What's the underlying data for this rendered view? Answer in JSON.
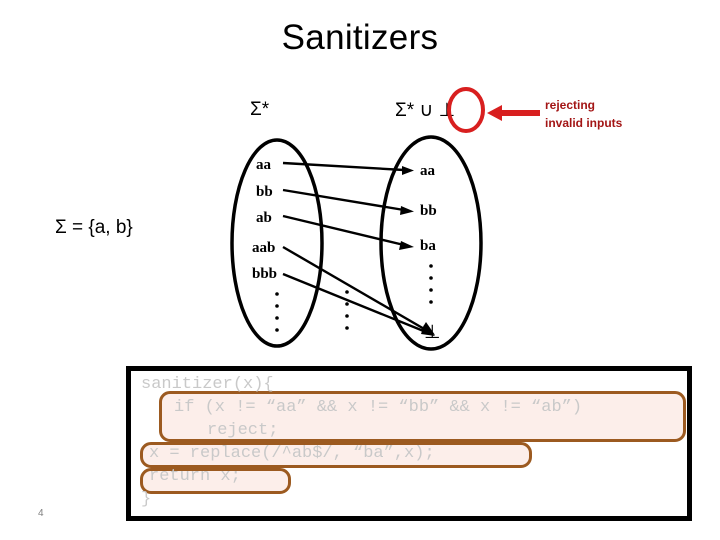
{
  "slide": {
    "title": "Sanitizers",
    "page_number": "4"
  },
  "labels": {
    "left_set": "Σ*",
    "right_set": "Σ* ∪ ⊥",
    "alphabet": "Σ = {a, b}"
  },
  "annotation": {
    "line1": "rejecting",
    "line2": "invalid inputs",
    "color": "#a31515"
  },
  "diagram": {
    "left_set_elements": [
      "aa",
      "bb",
      "ab",
      "aab",
      "bbb"
    ],
    "left_set_ellipsis": "⋮",
    "middle_ellipsis": "⋮",
    "right_set_elements": [
      "aa",
      "bb",
      "ba"
    ],
    "right_set_ellipsis": "⋮",
    "right_set_bottom": "⊥",
    "mappings": [
      {
        "from": "aa",
        "to": "aa"
      },
      {
        "from": "bb",
        "to": "bb"
      },
      {
        "from": "ab",
        "to": "ba"
      },
      {
        "from": "aab",
        "to": "⊥"
      },
      {
        "from": "bbb",
        "to": "⊥"
      }
    ]
  },
  "code": {
    "lines": [
      "sanitizer(x){",
      "if (x != “aa” && x != “bb” && x != “ab”)",
      "reject;",
      "x = replace(/^ab$/, “ba”,x);",
      "return x;",
      "}"
    ],
    "highlight_border_color": "#9c5a20",
    "highlight_fill_color": "#fceeea",
    "text_color": "#c9c9c9"
  }
}
